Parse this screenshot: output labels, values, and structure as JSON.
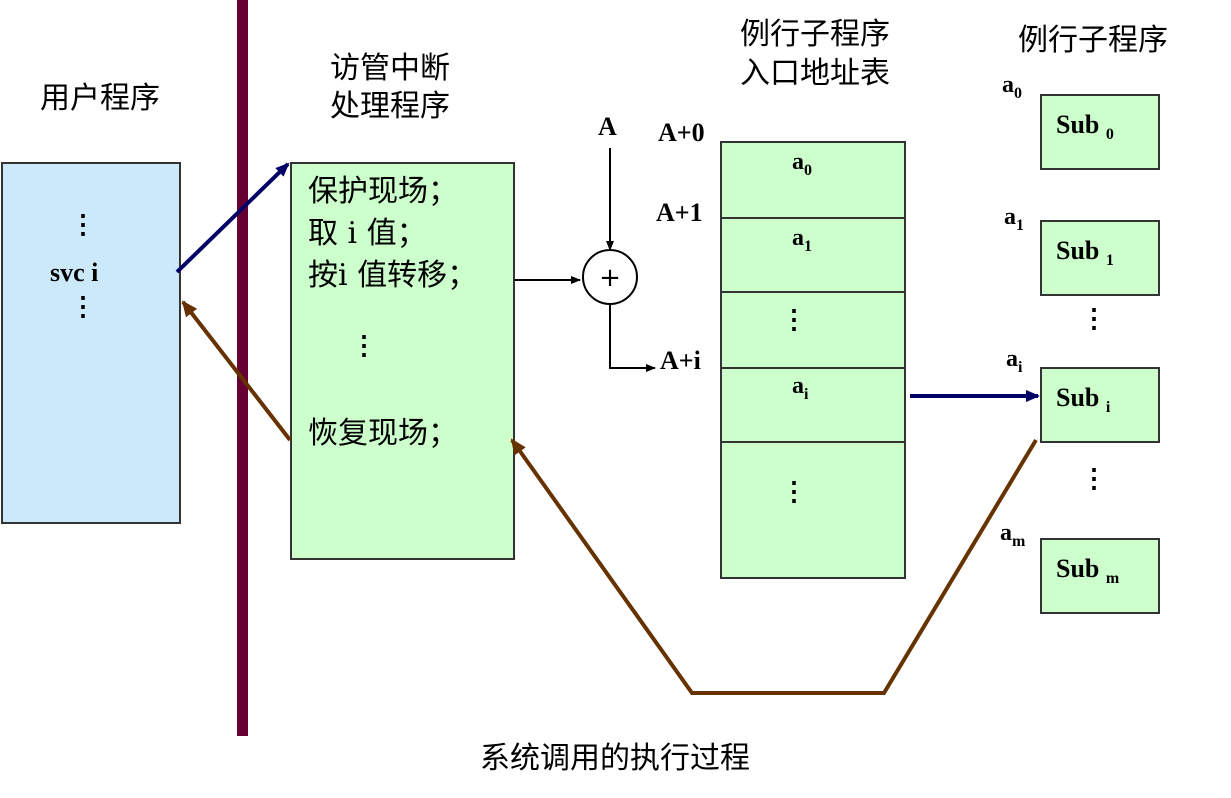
{
  "columns": {
    "user_program": "用户程序",
    "svc_handler_line1": "访管中断",
    "svc_handler_line2": "处理程序",
    "address_table_line1": "例行子程序",
    "address_table_line2": "入口地址表",
    "subroutines": "例行子程序"
  },
  "user_box": {
    "dots": "⋮",
    "svc": "svc i"
  },
  "handler_box": {
    "line1": "保护现场；",
    "line2": "取 i 值；",
    "line3": "按i 值转移；",
    "dots": "⋮",
    "line4": "恢复现场；"
  },
  "adder": {
    "input_label": "A",
    "symbol": "+"
  },
  "address_labels": {
    "a0": "A+0",
    "a1": "A+1",
    "ai": "A+i"
  },
  "table_cells": [
    {
      "base": "a",
      "sub": "0"
    },
    {
      "base": "a",
      "sub": "1"
    },
    {
      "dots": "⋮"
    },
    {
      "base": "a",
      "sub": "i"
    },
    {
      "dots": "⋮"
    }
  ],
  "subroutines": [
    {
      "addr_base": "a",
      "addr_sub": "0",
      "name": "Sub",
      "name_sub": "0"
    },
    {
      "addr_base": "a",
      "addr_sub": "1",
      "name": "Sub",
      "name_sub": "1"
    },
    {
      "addr_base": "a",
      "addr_sub": "i",
      "name": "Sub",
      "name_sub": "i"
    },
    {
      "addr_base": "a",
      "addr_sub": "m",
      "name": "Sub",
      "name_sub": "m"
    }
  ],
  "sub_dots": "⋮",
  "caption": "系统调用的执行过程",
  "colors": {
    "divider": "#660033",
    "call_arrow": "#000066",
    "return_arrow": "#663300",
    "user_fill": "#cce9fa",
    "green_fill": "#ccffcc"
  }
}
